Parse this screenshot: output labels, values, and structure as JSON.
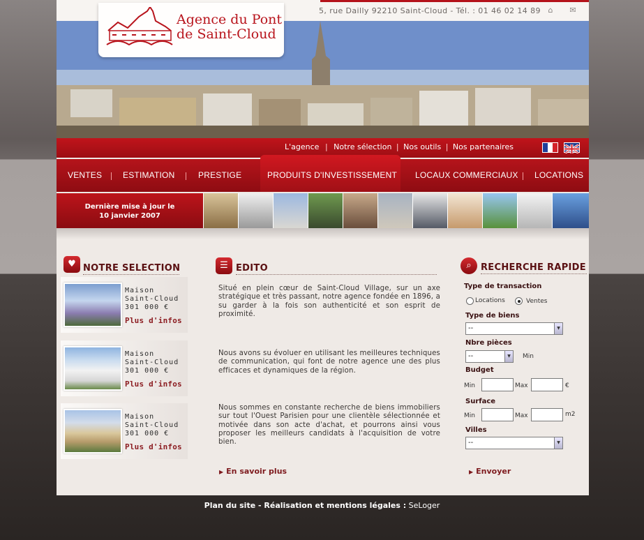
{
  "header": {
    "logo_line1": "Agence du Pont",
    "logo_line2": "de Saint-Cloud",
    "address": "5, rue Dailly 92210 Saint-Cloud - Tél. : 01 46 02 14 89"
  },
  "subnav": {
    "items": [
      "L'agence",
      "Notre sélection",
      "Nos outils",
      "Nos partenaires"
    ]
  },
  "mainnav": {
    "items": [
      "Ventes",
      "Estimation",
      "Prestige",
      "Produits d'investissement",
      "Locaux commerciaux",
      "Locations"
    ]
  },
  "banner": {
    "update_line1": "Dernière mise à jour le",
    "update_line2": "10 janvier 2007"
  },
  "selection": {
    "title": "NOTRE SELECTION",
    "items": [
      {
        "type": "Maison",
        "city": "Saint-Cloud",
        "price": "301 000 €",
        "link": "Plus d'infos"
      },
      {
        "type": "Maison",
        "city": "Saint-Cloud",
        "price": "301 000 €",
        "link": "Plus d'infos"
      },
      {
        "type": "Maison",
        "city": "Saint-Cloud",
        "price": "301 000 €",
        "link": "Plus d'infos"
      }
    ]
  },
  "edito": {
    "title": "EDITO",
    "p1": "Situé en plein cœur de Saint-Cloud Village, sur un axe stratégique et très passant, notre agence fondée en 1896, a su garder à la fois son authenticité et son esprit de proximité.",
    "p2": "Nous avons su évoluer en utilisant les meilleures techniques de communication, qui font de notre agence une des plus efficaces et dynamiques de la région.",
    "p3": "Nous sommes en constante recherche de biens immobiliers sur tout l'Ouest Parisien pour une clientèle sélectionnée et motivée dans son acte d'achat, et pourrons ainsi vous proposer les meilleurs candidats à l'acquisition de votre bien.",
    "more": "En savoir plus"
  },
  "search": {
    "title": "RECHERCHE RAPIDE",
    "transaction_label": "Type de transaction",
    "opt_locations": "Locations",
    "opt_ventes": "Ventes",
    "selected_transaction": "Ventes",
    "type_label": "Type de biens",
    "type_value": "-- ",
    "pieces_label": "Nbre pièces",
    "pieces_value": "--",
    "pieces_min": "Min",
    "budget_label": "Budget",
    "budget_min": "Min",
    "budget_max": "Max",
    "budget_unit": "€",
    "surface_label": "Surface",
    "surface_min": "Min",
    "surface_max": "Max",
    "surface_unit": "m2",
    "villes_label": "Villes",
    "villes_value": "-- ",
    "submit": "Envoyer"
  },
  "footer": {
    "text": "Plan du site - Réalisation et mentions légales :",
    "credit": "SeLoger"
  }
}
